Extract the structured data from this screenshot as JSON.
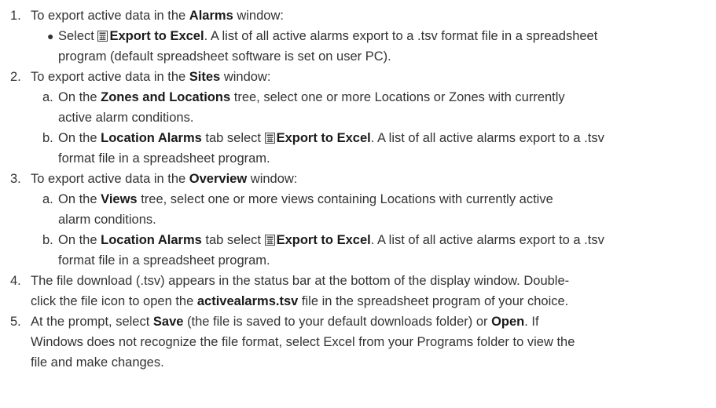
{
  "steps": [
    {
      "num": "1.",
      "parts": [
        "To export active data in the ",
        "Alarms",
        " window:"
      ],
      "bullets": [
        {
          "lines": [
            [
              "Select ",
              "Export to Excel",
              ". A list of all active alarms export to a .tsv format file in a spreadsheet"
            ],
            [
              "program (default spreadsheet software is set on user PC)."
            ]
          ]
        }
      ]
    },
    {
      "num": "2.",
      "parts": [
        "To export active data in the ",
        "Sites",
        " window:"
      ],
      "subs": [
        {
          "letter": "a.",
          "line1": [
            "On the ",
            "Zones and Locations",
            " tree, select one or more Locations or Zones with currently"
          ],
          "line2": "active alarm conditions."
        },
        {
          "letter": "b.",
          "line1": [
            "On the ",
            "Location Alarms",
            " tab select ",
            "Export to Excel",
            ". A list of all active alarms export to a .tsv"
          ],
          "line2": "format file in a spreadsheet program."
        }
      ]
    },
    {
      "num": "3.",
      "parts": [
        "To export active data in the ",
        "Overview",
        " window:"
      ],
      "subs": [
        {
          "letter": "a.",
          "line1": [
            "On the ",
            "Views",
            " tree, select one or more views containing Locations with currently active"
          ],
          "line2": "alarm conditions."
        },
        {
          "letter": "b.",
          "line1": [
            "On the ",
            "Location Alarms",
            " tab select ",
            "Export to Excel",
            ". A list of all active alarms export to a .tsv"
          ],
          "line2": "format file in a spreadsheet program."
        }
      ]
    },
    {
      "num": "4.",
      "line1": "The file download (.tsv) appears in the status bar at the bottom of the display window. Double-",
      "line2": [
        "click the file icon to open the ",
        "activealarms.tsv",
        " file in the spreadsheet program of your choice."
      ]
    },
    {
      "num": "5.",
      "line1": [
        "At the prompt, select ",
        "Save",
        " (the file is saved to your default downloads folder) or ",
        "Open",
        ". If"
      ],
      "line2": "Windows does not recognize the file format, select Excel from your Programs folder to view the",
      "line3": "file and make changes."
    }
  ],
  "icons": {
    "export": "excel-export-icon"
  }
}
